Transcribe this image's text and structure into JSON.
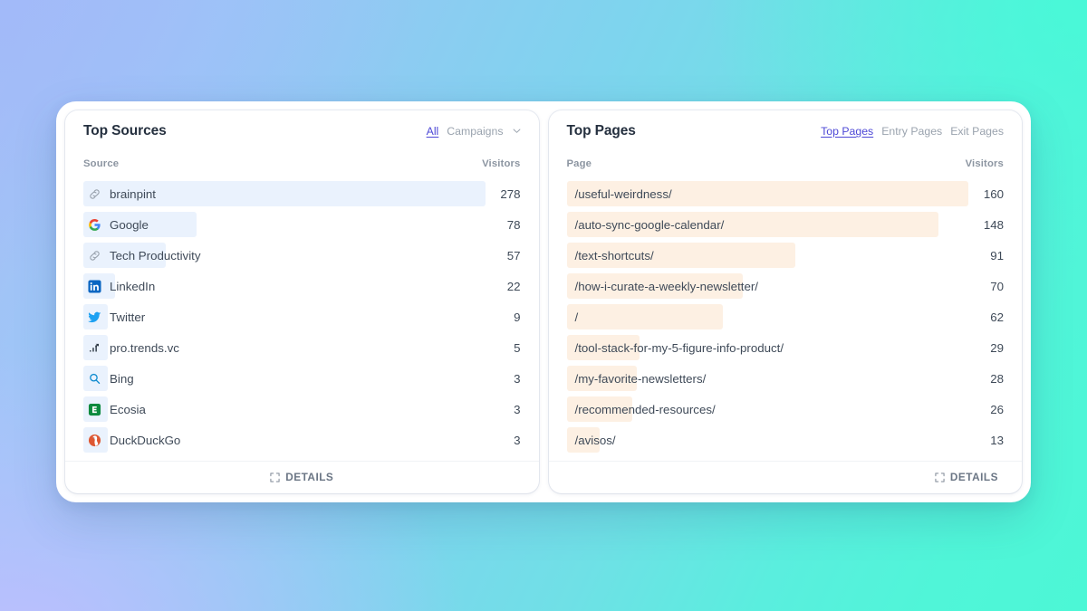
{
  "background": {
    "gradient_from": "#a8bdf5",
    "gradient_mid": "#7ed4ee",
    "gradient_to": "#4cf7d6"
  },
  "accent_color": "#4d48d6",
  "panels": [
    {
      "id": "top-sources",
      "title": "Top Sources",
      "tabs": [
        {
          "label": "All",
          "active": true
        },
        {
          "label": "Campaigns",
          "active": false
        }
      ],
      "has_chevron": true,
      "columns": {
        "label": "Source",
        "value": "Visitors"
      },
      "bar_color": "#eaf2fd",
      "footer_label": "DETAILS",
      "rows": [
        {
          "label": "brainpint",
          "value": 278,
          "icon": "link-icon"
        },
        {
          "label": "Google",
          "value": 78,
          "icon": "google-icon"
        },
        {
          "label": "Tech Productivity",
          "value": 57,
          "icon": "link-icon"
        },
        {
          "label": "LinkedIn",
          "value": 22,
          "icon": "linkedin-icon"
        },
        {
          "label": "Twitter",
          "value": 9,
          "icon": "twitter-icon"
        },
        {
          "label": "pro.trends.vc",
          "value": 5,
          "icon": "trends-icon"
        },
        {
          "label": "Bing",
          "value": 3,
          "icon": "bing-icon"
        },
        {
          "label": "Ecosia",
          "value": 3,
          "icon": "ecosia-icon"
        },
        {
          "label": "DuckDuckGo",
          "value": 3,
          "icon": "duckduckgo-icon"
        }
      ]
    },
    {
      "id": "top-pages",
      "title": "Top Pages",
      "tabs": [
        {
          "label": "Top Pages",
          "active": true
        },
        {
          "label": "Entry Pages",
          "active": false
        },
        {
          "label": "Exit Pages",
          "active": false
        }
      ],
      "has_chevron": false,
      "columns": {
        "label": "Page",
        "value": "Visitors"
      },
      "bar_color": "#fdf0e3",
      "footer_label": "DETAILS",
      "rows": [
        {
          "label": "/useful-weirdness/",
          "value": 160
        },
        {
          "label": "/auto-sync-google-calendar/",
          "value": 148
        },
        {
          "label": "/text-shortcuts/",
          "value": 91
        },
        {
          "label": "/how-i-curate-a-weekly-newsletter/",
          "value": 70
        },
        {
          "label": "/",
          "value": 62
        },
        {
          "label": "/tool-stack-for-my-5-figure-info-product/",
          "value": 29
        },
        {
          "label": "/my-favorite-newsletters/",
          "value": 28
        },
        {
          "label": "/recommended-resources/",
          "value": 26
        },
        {
          "label": "/avisos/",
          "value": 13
        }
      ]
    }
  ],
  "chart_data": [
    {
      "type": "bar",
      "title": "Top Sources",
      "xlabel": "Visitors",
      "ylabel": "Source",
      "orientation": "horizontal",
      "categories": [
        "brainpint",
        "Google",
        "Tech Productivity",
        "LinkedIn",
        "Twitter",
        "pro.trends.vc",
        "Bing",
        "Ecosia",
        "DuckDuckGo"
      ],
      "values": [
        278,
        78,
        57,
        22,
        9,
        5,
        3,
        3,
        3
      ],
      "xlim": [
        0,
        278
      ],
      "grid": false,
      "legend": "none",
      "bar_color": "#eaf2fd"
    },
    {
      "type": "bar",
      "title": "Top Pages",
      "xlabel": "Visitors",
      "ylabel": "Page",
      "orientation": "horizontal",
      "categories": [
        "/useful-weirdness/",
        "/auto-sync-google-calendar/",
        "/text-shortcuts/",
        "/how-i-curate-a-weekly-newsletter/",
        "/",
        "/tool-stack-for-my-5-figure-info-product/",
        "/my-favorite-newsletters/",
        "/recommended-resources/",
        "/avisos/"
      ],
      "values": [
        160,
        148,
        91,
        70,
        62,
        29,
        28,
        26,
        13
      ],
      "xlim": [
        0,
        160
      ],
      "grid": false,
      "legend": "none",
      "bar_color": "#fdf0e3"
    }
  ]
}
